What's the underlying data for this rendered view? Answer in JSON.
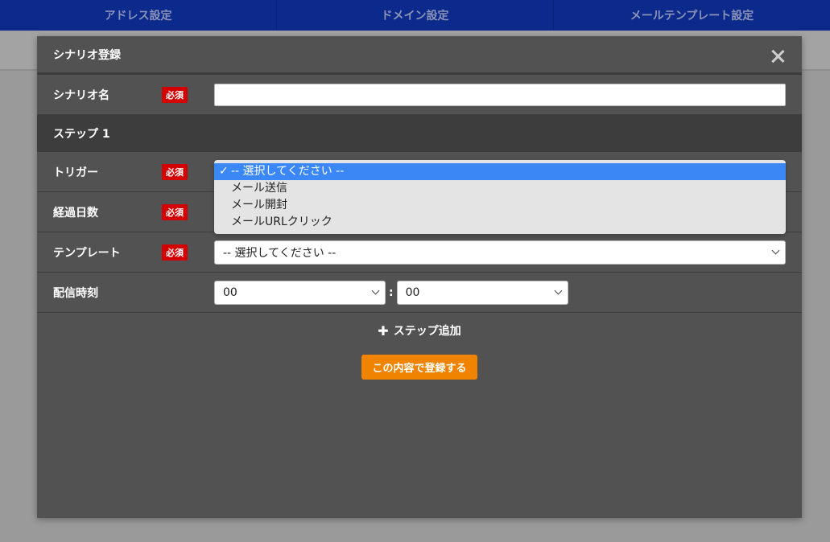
{
  "nav": {
    "items": [
      "アドレス設定",
      "ドメイン設定",
      "メールテンプレート設定"
    ]
  },
  "modal": {
    "title": "シナリオ登録",
    "scenario_name_label": "シナリオ名",
    "required_badge": "必須",
    "step_header": "ステップ 1",
    "trigger_label": "トリガー",
    "days_label": "経過日数",
    "template_label": "テンプレート",
    "template_value": "-- 選択してください --",
    "time_label": "配信時刻",
    "hour_value": "00",
    "minute_value": "00",
    "time_separator": ":",
    "add_step_label": "ステップ追加",
    "submit_label": "この内容で登録する"
  },
  "trigger_dropdown": {
    "check": "✓",
    "options": [
      "-- 選択してください --",
      "メール送信",
      "メール開封",
      "メールURLクリック"
    ],
    "selected_index": 0
  }
}
